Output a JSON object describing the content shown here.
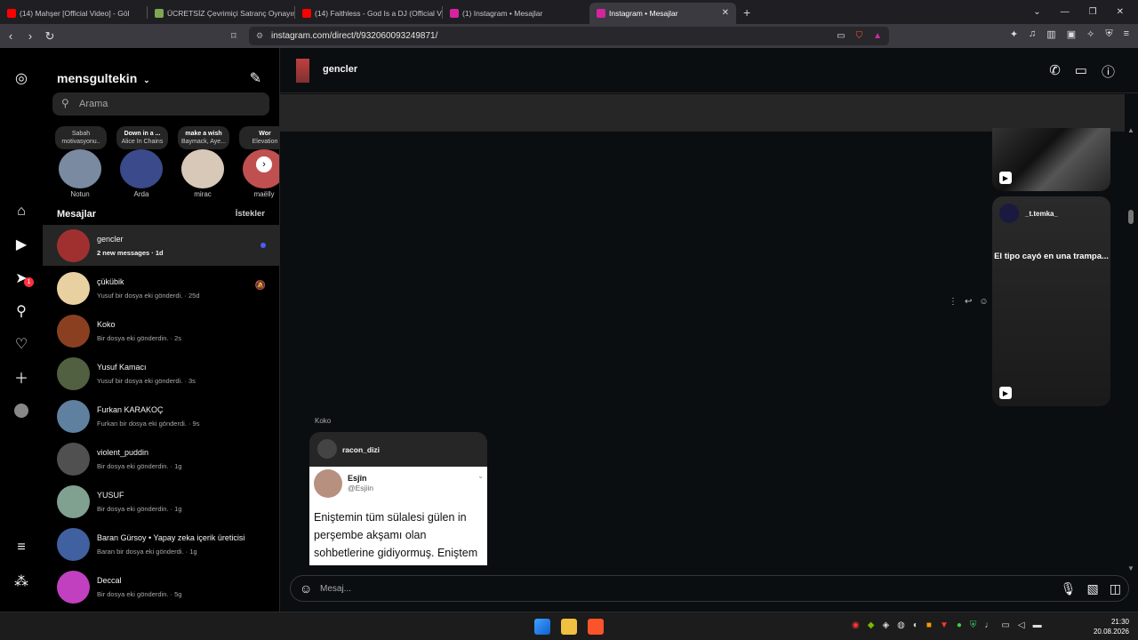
{
  "browser": {
    "tabs": [
      {
        "label": "(14) Mahşer [Official Video] - Göl",
        "fav_color": "#ff0000",
        "active": false
      },
      {
        "label": "ÜCRETSİZ Çevrimiçi Satranç Oynayın",
        "fav_color": "#7fa650",
        "active": false
      },
      {
        "label": "(14) Faithless - God Is a DJ (Official V",
        "fav_color": "#ff0000",
        "active": false
      },
      {
        "label": "(1) Instagram • Mesajlar",
        "fav_color": "#d6249f",
        "active": false
      },
      {
        "label": "Instagram • Mesajlar",
        "fav_color": "#d6249f",
        "active": true
      }
    ],
    "new_tab": "+",
    "url": "instagram.com/direct/t/932060093249871/"
  },
  "nav": {
    "badge": "1"
  },
  "sidebar": {
    "username": "mensgultekin",
    "search_placeholder": "Arama",
    "notes": [
      {
        "line1": "Sabah",
        "line2": "motivasyonu..",
        "name": "Notun",
        "color": "#7a8aa0"
      },
      {
        "line1": "Down in a ...",
        "line2": "Alice In Chains",
        "name": "Arda",
        "color": "#3a4a8a"
      },
      {
        "line1": "make a wish",
        "line2": "Baymack, Aye...",
        "name": "mirac",
        "color": "#d8c8b8"
      },
      {
        "line1": "Wor",
        "line2": "Elevation",
        "name": "maëlly",
        "color": "#c05050"
      }
    ],
    "messages_header": "Mesajlar",
    "requests_label": "İstekler",
    "conversations": [
      {
        "name": "gencler",
        "preview": "2 new messages · 1d",
        "color": "#a03030",
        "active": true,
        "unread": true,
        "muted": false
      },
      {
        "name": "çükübik",
        "preview": "Yusuf bir dosya eki gönderdi. · 25d",
        "color": "#e8d0a0",
        "active": false,
        "unread": false,
        "muted": true
      },
      {
        "name": "Koko",
        "preview": "Bir dosya eki gönderdin. · 2s",
        "color": "#8a4020",
        "active": false,
        "unread": false,
        "muted": false
      },
      {
        "name": "Yusuf Kamacı",
        "preview": "Yusuf bir dosya eki gönderdi. · 3s",
        "color": "#506040",
        "active": false,
        "unread": false,
        "muted": false
      },
      {
        "name": "Furkan KARAKOÇ",
        "preview": "Furkan bir dosya eki gönderdi. · 9s",
        "color": "#6080a0",
        "active": false,
        "unread": false,
        "muted": false
      },
      {
        "name": "violent_puddin",
        "preview": "Bir dosya eki gönderdin. · 1g",
        "color": "#505050",
        "active": false,
        "unread": false,
        "muted": false
      },
      {
        "name": "YUSUF",
        "preview": "Bir dosya eki gönderdin. · 1g",
        "color": "#80a090",
        "active": false,
        "unread": false,
        "muted": false
      },
      {
        "name": "Baran Gürsoy • Yapay zeka içerik üreticisi",
        "preview": "Baran bir dosya eki gönderdi. · 1g",
        "color": "#4060a0",
        "active": false,
        "unread": false,
        "muted": false
      },
      {
        "name": "Deccal",
        "preview": "Bir dosya eki gönderdin. · 5g",
        "color": "#c040c0",
        "active": false,
        "unread": false,
        "muted": false
      }
    ]
  },
  "chat": {
    "title": "gencler",
    "reel_author": "_t.temka_",
    "reel_caption": "El tipo cayó en una trampa...",
    "sender": "Koko",
    "shared_author": "racon_dizi",
    "tweet": {
      "name": "Esjîn",
      "handle": "@Esjiin",
      "text": "Eniştemin tüm sülalesi gülen in perşembe akşamı olan sohbetlerine gidiyormuş. Eniştem"
    },
    "composer_placeholder": "Mesaj..."
  },
  "taskbar": {
    "time": "21:30",
    "date": "20.08.2026"
  }
}
